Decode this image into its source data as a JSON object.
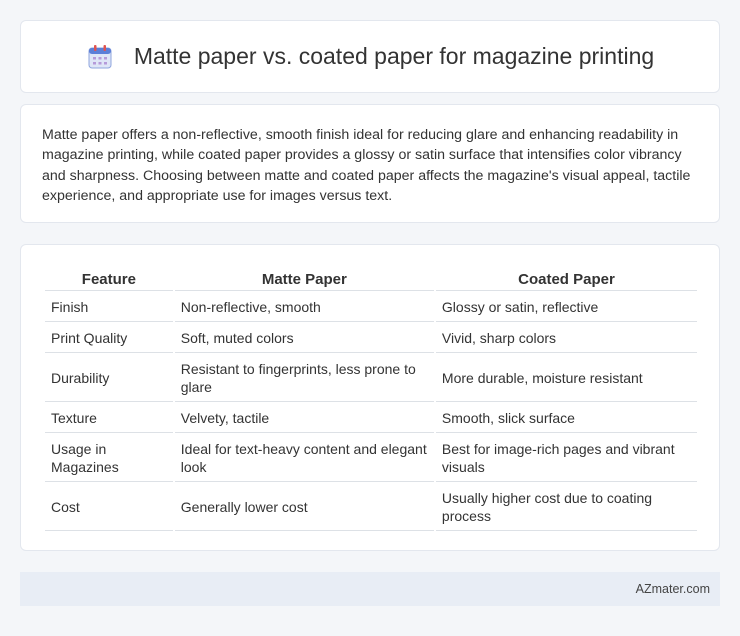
{
  "header": {
    "title": "Matte paper vs. coated paper for magazine printing",
    "icon": "calendar-icon"
  },
  "intro": {
    "text": "Matte paper offers a non-reflective, smooth finish ideal for reducing glare and enhancing readability in magazine printing, while coated paper provides a glossy or satin surface that intensifies color vibrancy and sharpness. Choosing between matte and coated paper affects the magazine's visual appeal, tactile experience, and appropriate use for images versus text."
  },
  "table": {
    "headers": [
      "Feature",
      "Matte Paper",
      "Coated Paper"
    ],
    "rows": [
      [
        "Finish",
        "Non-reflective, smooth",
        "Glossy or satin, reflective"
      ],
      [
        "Print Quality",
        "Soft, muted colors",
        "Vivid, sharp colors"
      ],
      [
        "Durability",
        "Resistant to fingerprints, less prone to glare",
        "More durable, moisture resistant"
      ],
      [
        "Texture",
        "Velvety, tactile",
        "Smooth, slick surface"
      ],
      [
        "Usage in Magazines",
        "Ideal for text-heavy content and elegant look",
        "Best for image-rich pages and vibrant visuals"
      ],
      [
        "Cost",
        "Generally lower cost",
        "Usually higher cost due to coating process"
      ]
    ]
  },
  "footer": {
    "brand": "AZmater.com"
  }
}
